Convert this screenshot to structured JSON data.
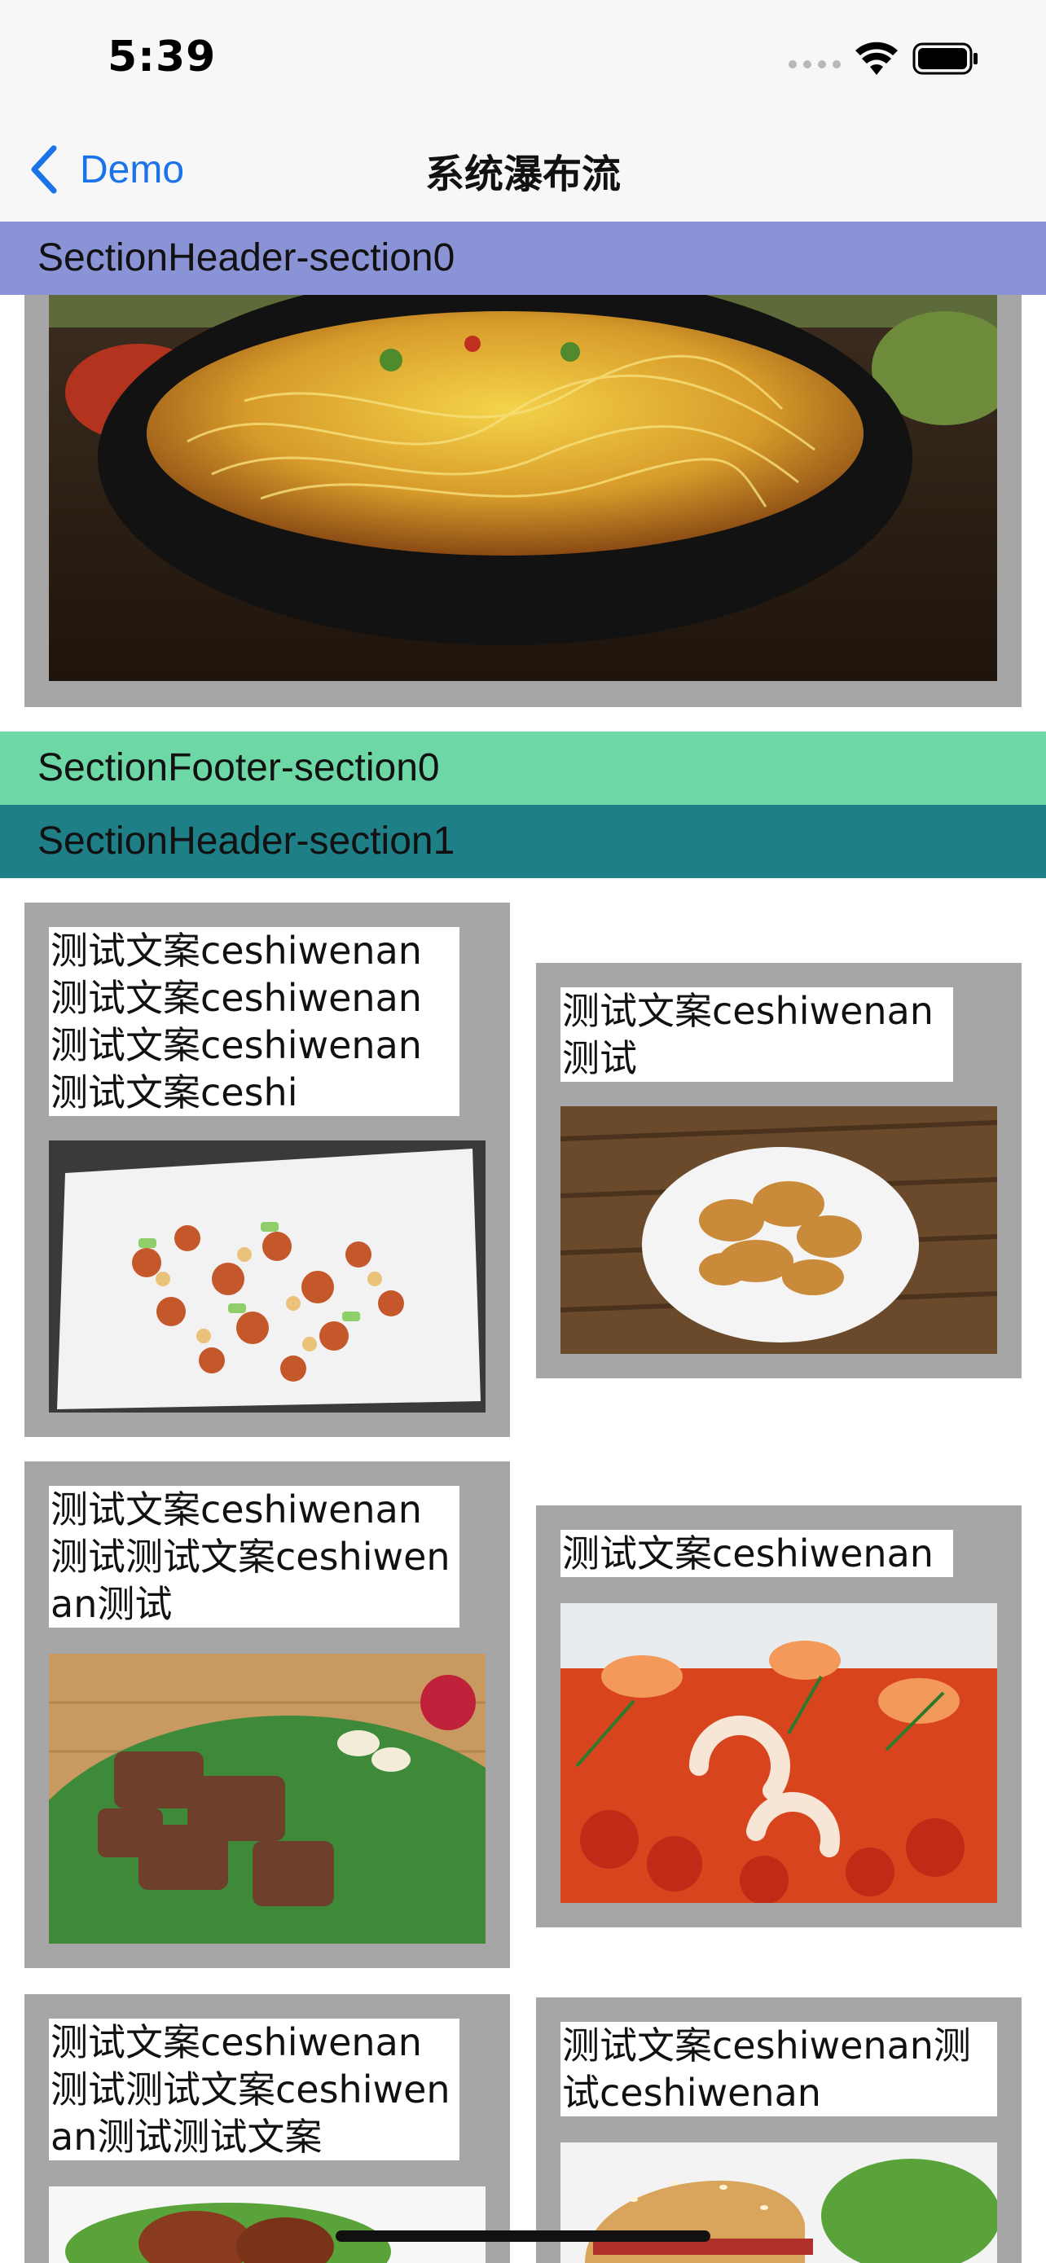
{
  "status_bar": {
    "time": "5:39"
  },
  "nav": {
    "back_label": "Demo",
    "title": "系统瀑布流"
  },
  "section0": {
    "header": "SectionHeader-section0",
    "footer": "SectionFooter-section0"
  },
  "section1": {
    "header": "SectionHeader-section1",
    "items": [
      {
        "caption": "测试文案ceshiwenan测试文案ceshiwenan测试文案ceshiwenan测试文案ceshi",
        "photo": "spicy-chicken-peanuts"
      },
      {
        "caption": "测试文案ceshiwenan测试",
        "photo": "fried-pork-plate"
      },
      {
        "caption": "测试文案ceshiwenan测试测试文案ceshiwenan测试",
        "photo": "grilled-meat-leaf"
      },
      {
        "caption": "测试文案ceshiwenan",
        "photo": "shrimp-squid-tomato"
      },
      {
        "caption": "测试文案ceshiwenan测试测试文案ceshiwenan测试测试文案",
        "photo": "meat-salad"
      },
      {
        "caption": "测试文案ceshiwenan测试ceshiwenan",
        "photo": "burger"
      }
    ]
  },
  "colors": {
    "header0": "#8a93d6",
    "footer0": "#6dd7a6",
    "header1": "#1f7f86",
    "cell_bg": "#a6a6a6",
    "accent": "#1a73e8"
  }
}
